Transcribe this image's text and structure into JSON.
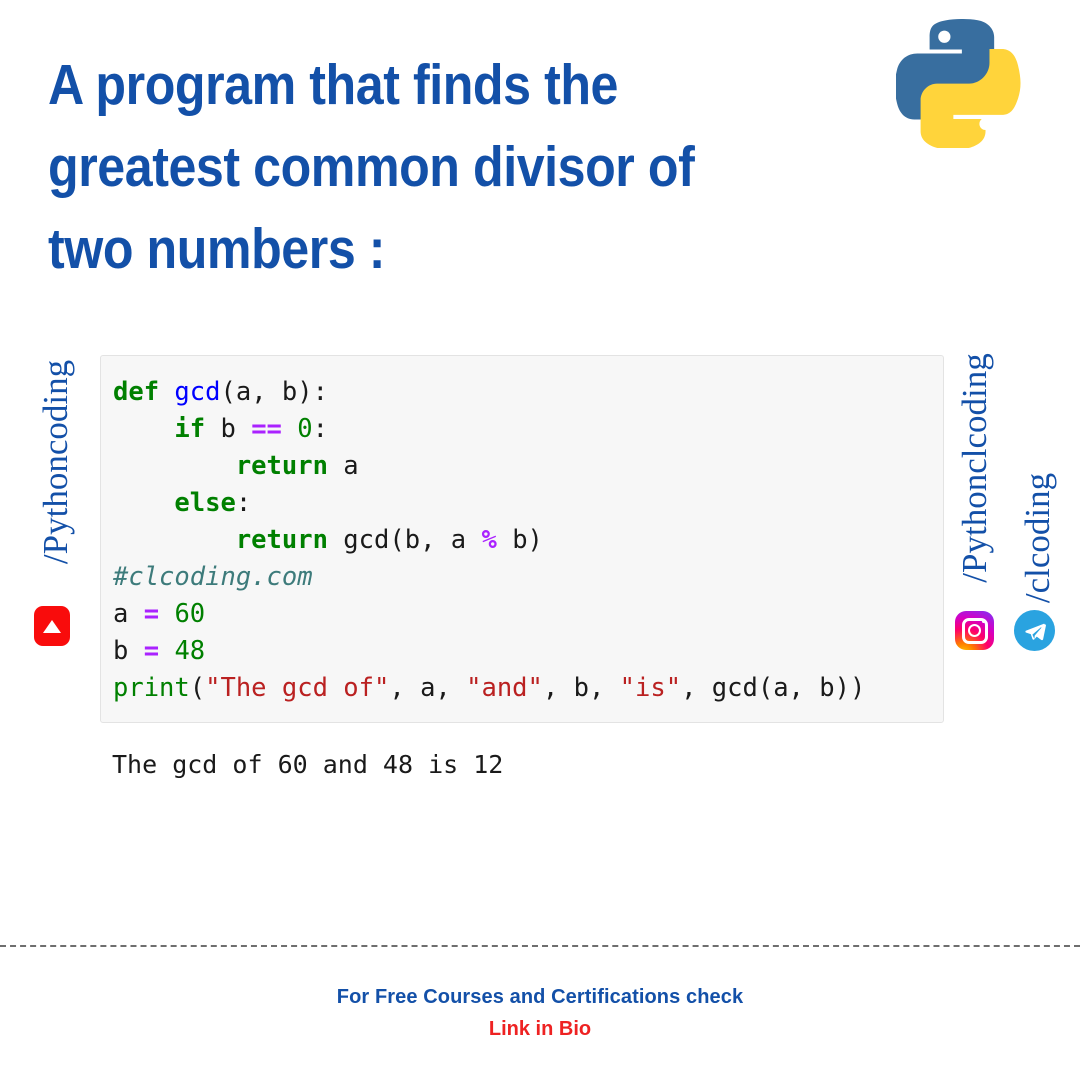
{
  "title": "A program that finds the\ngreatest common divisor of\ntwo numbers :",
  "brand": {
    "accent_blue": "#1350a8",
    "accent_red": "#ee2222",
    "python_blue": "#386e9f",
    "python_yellow": "#ffd43b"
  },
  "logo": {
    "name": "python-logo"
  },
  "social": {
    "left": {
      "handle": "/Pythoncoding",
      "icon": "youtube-icon"
    },
    "right_top": {
      "handle": "/Pythonclcoding",
      "icon": "instagram-icon"
    },
    "right_bottom": {
      "handle": "/clcoding",
      "icon": "telegram-icon"
    }
  },
  "code": {
    "language": "python",
    "lines": [
      "def gcd(a, b):",
      "    if b == 0:",
      "        return a",
      "    else:",
      "        return gcd(b, a % b)",
      "#clcoding.com",
      "a = 60",
      "b = 48",
      "print(\"The gcd of\", a, \"and\", b, \"is\", gcd(a, b))"
    ],
    "output": "The gcd of 60 and 48 is 12"
  },
  "footer": {
    "line1": "For Free Courses and Certifications check",
    "line2": "Link in Bio"
  }
}
